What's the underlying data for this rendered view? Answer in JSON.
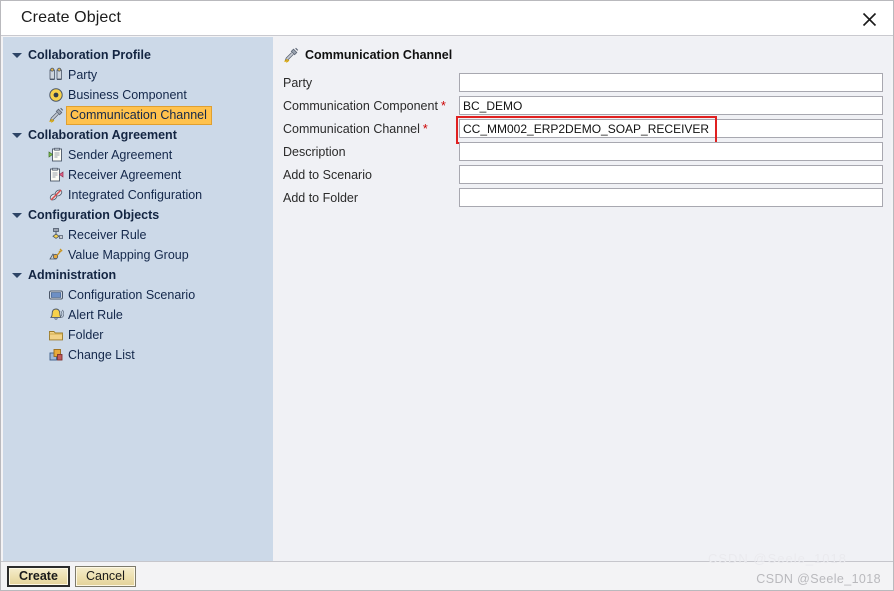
{
  "window": {
    "title": "Create Object",
    "close_icon": "close-icon"
  },
  "tree": {
    "groups": [
      {
        "label": "Collaboration Profile",
        "icon": "triangle-down-icon",
        "items": [
          {
            "label": "Party",
            "icon": "party-icon",
            "selected": false
          },
          {
            "label": "Business Component",
            "icon": "business-component-icon",
            "selected": false
          },
          {
            "label": "Communication Channel",
            "icon": "communication-channel-icon",
            "selected": true
          }
        ]
      },
      {
        "label": "Collaboration Agreement",
        "icon": "triangle-down-icon",
        "items": [
          {
            "label": "Sender Agreement",
            "icon": "sender-agreement-icon",
            "selected": false
          },
          {
            "label": "Receiver Agreement",
            "icon": "receiver-agreement-icon",
            "selected": false
          },
          {
            "label": "Integrated Configuration",
            "icon": "integrated-configuration-icon",
            "selected": false
          }
        ]
      },
      {
        "label": "Configuration Objects",
        "icon": "triangle-down-icon",
        "items": [
          {
            "label": "Receiver Rule",
            "icon": "receiver-rule-icon",
            "selected": false
          },
          {
            "label": "Value Mapping Group",
            "icon": "value-mapping-group-icon",
            "selected": false
          }
        ]
      },
      {
        "label": "Administration",
        "icon": "triangle-down-icon",
        "items": [
          {
            "label": "Configuration Scenario",
            "icon": "configuration-scenario-icon",
            "selected": false
          },
          {
            "label": "Alert Rule",
            "icon": "alert-rule-icon",
            "selected": false
          },
          {
            "label": "Folder",
            "icon": "folder-icon",
            "selected": false
          },
          {
            "label": "Change List",
            "icon": "change-list-icon",
            "selected": false
          }
        ]
      }
    ]
  },
  "form": {
    "header": "Communication Channel",
    "header_icon": "communication-channel-icon",
    "fields": [
      {
        "label": "Party",
        "required": false,
        "value": "",
        "placeholder": ""
      },
      {
        "label": "Communication Component",
        "required": true,
        "value": "BC_DEMO",
        "placeholder": ""
      },
      {
        "label": "Communication Channel",
        "required": true,
        "value": "CC_MM002_ERP2DEMO_SOAP_RECEIVER",
        "placeholder": "",
        "highlighted": true
      },
      {
        "label": "Description",
        "required": false,
        "value": "",
        "placeholder": ""
      },
      {
        "label": "Add to Scenario",
        "required": false,
        "value": "",
        "placeholder": ""
      },
      {
        "label": "Add to Folder",
        "required": false,
        "value": "",
        "placeholder": ""
      }
    ],
    "required_marker": "*",
    "highlight_color": "#e02020"
  },
  "footer": {
    "create_label": "Create",
    "cancel_label": "Cancel"
  },
  "watermark": {
    "text": "CSDN @Seele_1018",
    "faint_text": "CSDN @Seele_1018"
  }
}
